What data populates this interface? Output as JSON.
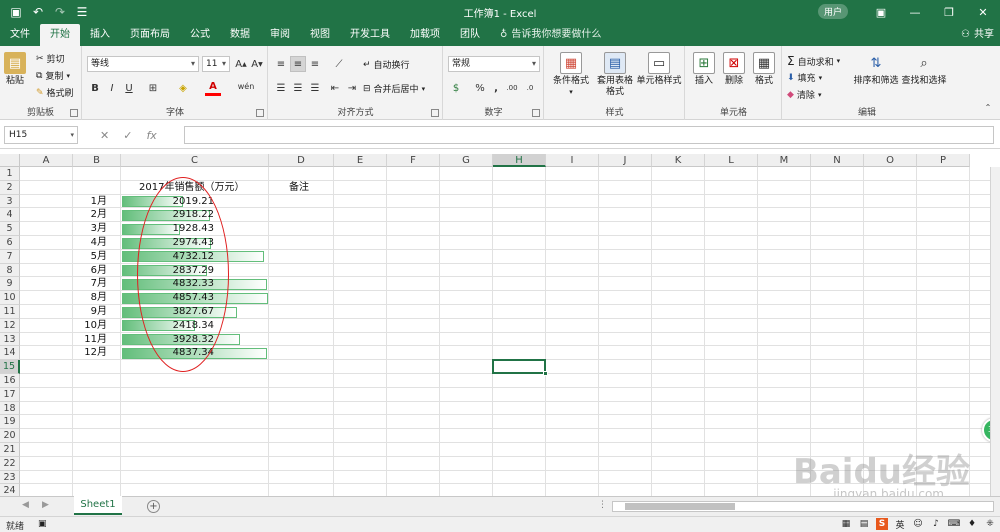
{
  "title": {
    "doc": "工作簿1 - Excel",
    "user": "用户",
    "qat_icons": [
      "save-icon",
      "undo-icon",
      "redo-icon",
      "touch-mode-icon"
    ]
  },
  "tabs": [
    "文件",
    "开始",
    "插入",
    "页面布局",
    "公式",
    "数据",
    "审阅",
    "视图",
    "开发工具",
    "加载项",
    "团队"
  ],
  "active_tab": "开始",
  "tellme": "告诉我你想要做什么",
  "share": "共享",
  "ribbon": {
    "clipboard": {
      "label": "剪贴板",
      "paste": "粘贴",
      "cut": "剪切",
      "copy": "复制",
      "format_painter": "格式刷"
    },
    "font": {
      "label": "字体",
      "font_name": "等线",
      "font_size": "11",
      "bold": "B",
      "italic": "I",
      "underline": "U",
      "font_color_glyph": "A",
      "wen": "wén"
    },
    "alignment": {
      "label": "对齐方式",
      "wrap": "自动换行",
      "merge": "合并后居中"
    },
    "number": {
      "label": "数字",
      "format": "常规",
      "percent": "%",
      "comma": ",",
      "inc_dec": ".00",
      "dec_dec": ".0"
    },
    "styles": {
      "label": "样式",
      "cond": "条件格式",
      "table": "套用表格格式",
      "cell": "单元格样式"
    },
    "cells": {
      "label": "单元格",
      "insert": "插入",
      "delete": "删除",
      "format": "格式"
    },
    "editing": {
      "label": "编辑",
      "autosum": "自动求和",
      "fill": "填充",
      "clear": "清除",
      "sort": "排序和筛选",
      "find": "查找和选择"
    }
  },
  "formula_bar": {
    "name_box": "H15",
    "cancel": "✕",
    "enter": "✓",
    "fx": "fx",
    "content": ""
  },
  "columns": [
    "A",
    "B",
    "C",
    "D",
    "E",
    "F",
    "G",
    "H",
    "I",
    "J",
    "K",
    "L",
    "M",
    "N",
    "O",
    "P"
  ],
  "rows": [
    "1",
    "2",
    "3",
    "4",
    "5",
    "6",
    "7",
    "8",
    "9",
    "10",
    "11",
    "12",
    "13",
    "14",
    "15",
    "16",
    "17",
    "18",
    "19",
    "20",
    "21",
    "22",
    "23",
    "24"
  ],
  "selected_col": "H",
  "selected_row": "15",
  "table": {
    "header": "2017年销售额（万元）",
    "note_header": "备注",
    "max": 4857.43,
    "months": [
      {
        "month": "1月",
        "value": "2019.21",
        "num": 2019.21
      },
      {
        "month": "2月",
        "value": "2918.22",
        "num": 2918.22
      },
      {
        "month": "3月",
        "value": "1928.43",
        "num": 1928.43
      },
      {
        "month": "4月",
        "value": "2974.43",
        "num": 2974.43
      },
      {
        "month": "5月",
        "value": "4732.12",
        "num": 4732.12
      },
      {
        "month": "6月",
        "value": "2837.29",
        "num": 2837.29
      },
      {
        "month": "7月",
        "value": "4832.33",
        "num": 4832.33
      },
      {
        "month": "8月",
        "value": "4857.43",
        "num": 4857.43
      },
      {
        "month": "9月",
        "value": "3827.67",
        "num": 3827.67
      },
      {
        "month": "10月",
        "value": "2418.34",
        "num": 2418.34
      },
      {
        "month": "11月",
        "value": "3928.32",
        "num": 3928.32
      },
      {
        "month": "12月",
        "value": "4837.34",
        "num": 4837.34
      }
    ]
  },
  "sheet_tabs": [
    "Sheet1"
  ],
  "status": {
    "ready": "就绪"
  },
  "overlay": {
    "badge": "39",
    "watermark": "Baidu经验",
    "watermark_url": "jingyan.baidu.com"
  }
}
